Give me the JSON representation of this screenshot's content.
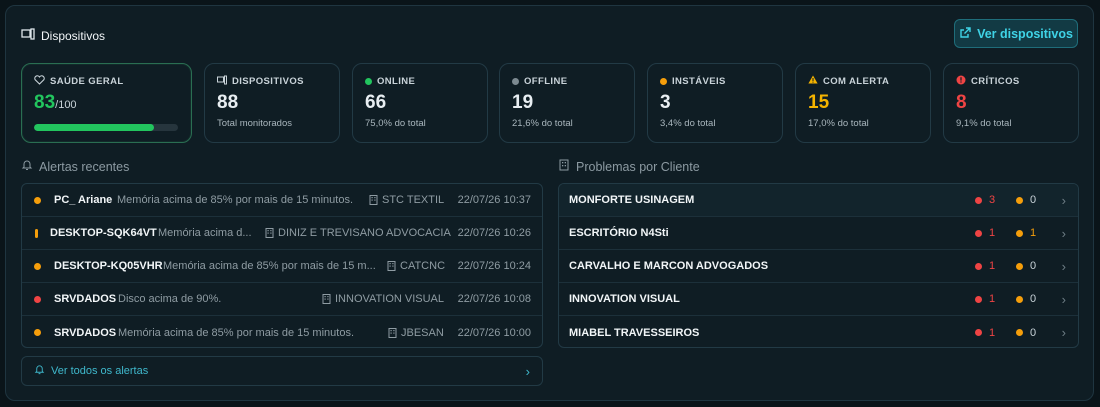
{
  "header": {
    "title": "Dispositivos",
    "button_label": "Ver dispositivos"
  },
  "stats": {
    "health": {
      "label": "SAÚDE GERAL",
      "value": "83",
      "suffix": "/100",
      "progress": 0.83,
      "color": "#22c55e"
    },
    "devices": {
      "label": "DISPOSITIVOS",
      "value": "88",
      "sub": "Total monitorados"
    },
    "online": {
      "label": "ONLINE",
      "value": "66",
      "sub": "75,0% do total",
      "color": "#22c55e"
    },
    "offline": {
      "label": "OFFLINE",
      "value": "19",
      "sub": "21,6% do total",
      "color": "#7d8a91"
    },
    "unstable": {
      "label": "INSTÁVEIS",
      "value": "3",
      "sub": "3,4% do total",
      "color": "#f59e0b"
    },
    "alert": {
      "label": "COM ALERTA",
      "value": "15",
      "sub": "17,0% do total",
      "color": "#f5b400"
    },
    "critical": {
      "label": "CRÍTICOS",
      "value": "8",
      "sub": "9,1% do total",
      "color": "#ef4444"
    }
  },
  "alerts_section": {
    "title": "Alertas recentes",
    "all_label": "Ver todos os alertas",
    "rows": [
      {
        "device": "PC_ Ariane",
        "message": "Memória acima de 85% por mais de 15 minutos.",
        "client": "STC TEXTIL",
        "time": "22/07/26 10:37",
        "color": "#f59e0b"
      },
      {
        "device": "DESKTOP-SQK64VT",
        "message": "Memória acima d...",
        "client": "DINIZ E TREVISANO ADVOCACIA",
        "time": "22/07/26 10:26",
        "color": "#f59e0b"
      },
      {
        "device": "DESKTOP-KQ05VHR",
        "message": "Memória acima de 85% por mais de 15 m...",
        "client": "CATCNC",
        "time": "22/07/26 10:24",
        "color": "#f59e0b"
      },
      {
        "device": "SRVDADOS",
        "message": "Disco acima de 90%.",
        "client": "INNOVATION VISUAL",
        "time": "22/07/26 10:08",
        "color": "#ef4444"
      },
      {
        "device": "SRVDADOS",
        "message": "Memória acima de 85% por mais de 15 minutos.",
        "client": "JBESAN",
        "time": "22/07/26 10:00",
        "color": "#f59e0b"
      }
    ]
  },
  "clients_section": {
    "title": "Problemas por Cliente",
    "rows": [
      {
        "name": "MONFORTE USINAGEM",
        "critical": "3",
        "warning": "0"
      },
      {
        "name": "ESCRITÓRIO N4Sti",
        "critical": "1",
        "warning": "1"
      },
      {
        "name": "CARVALHO E MARCON ADVOGADOS",
        "critical": "1",
        "warning": "0"
      },
      {
        "name": "INNOVATION VISUAL",
        "critical": "1",
        "warning": "0"
      },
      {
        "name": "MIABEL TRAVESSEIROS",
        "critical": "1",
        "warning": "0"
      }
    ]
  }
}
